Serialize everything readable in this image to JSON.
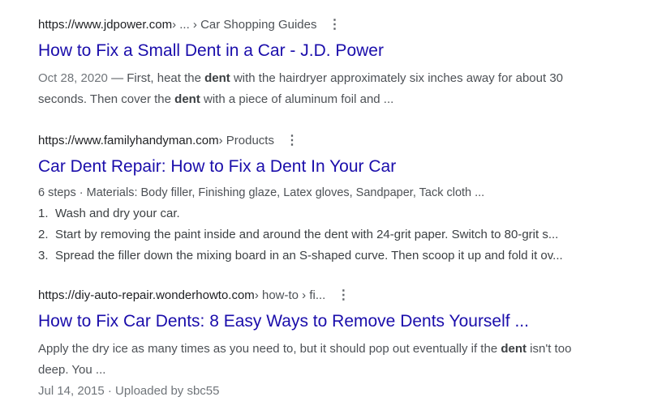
{
  "results": [
    {
      "url_host": "https://www.jdpower.com",
      "url_path": " › ... › Car Shopping Guides",
      "more_icon": "⋮",
      "title": "How to Fix a Small Dent in a Car - J.D. Power",
      "snippet": {
        "date": "Oct 28, 2020",
        "sep": " — ",
        "part1": "First, heat the ",
        "bold1": "dent",
        "part2": " with the hairdryer approximately six inches away for about 30 seconds. Then cover the ",
        "bold2": "dent",
        "part3": " with a piece of aluminum foil and ..."
      }
    },
    {
      "url_host": "https://www.familyhandyman.com",
      "url_path": " › Products",
      "more_icon": "⋮",
      "title": "Car Dent Repair: How to Fix a Dent In Your Car",
      "steps_meta": "6 steps · Materials: Body filler, Finishing glaze, Latex gloves, Sandpaper, Tack cloth ...",
      "steps": [
        {
          "num": "1.",
          "text": "Wash and dry your car."
        },
        {
          "num": "2.",
          "text": "Start by removing the paint inside and around the dent with 24-grit paper. Switch to 80-grit s..."
        },
        {
          "num": "3.",
          "text": "Spread the filler down the mixing board in an S-shaped curve. Then scoop it up and fold it ov..."
        }
      ]
    },
    {
      "url_host": "https://diy-auto-repair.wonderhowto.com",
      "url_path": " › how-to › fi...",
      "more_icon": "⋮",
      "title": "How to Fix Car Dents: 8 Easy Ways to Remove Dents Yourself ...",
      "snippet": {
        "part1": "Apply the dry ice as many times as you need to, but it should pop out eventually if the ",
        "bold1": "dent",
        "part2": " isn't too deep. You ..."
      },
      "meta": "Jul 14, 2015 · Uploaded by sbc55"
    }
  ]
}
